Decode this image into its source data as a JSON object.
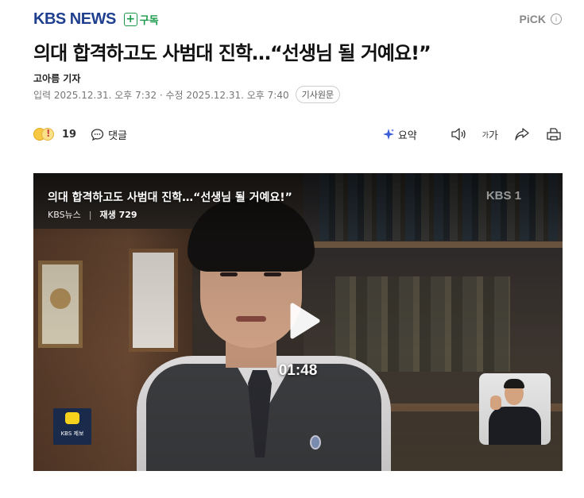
{
  "header": {
    "logo": "KBS NEWS",
    "subscribe_label": "구독",
    "pick_label": "PiCK",
    "info_glyph": "i"
  },
  "article": {
    "headline": "의대 합격하고도 사범대 진학…“선생님 될 거예요!”",
    "reporter": "고아름 기자",
    "dates": "입력 2025.12.31. 오후 7:32 · 수정 2025.12.31. 오후 7:40",
    "original_button": "기사원문"
  },
  "actions": {
    "reaction_count": "19",
    "comment_label": "댓글",
    "summary_label": "요약",
    "font_label_small": "가",
    "font_label_large": "가"
  },
  "video": {
    "title": "의대 합격하고도 사범대 진학…“선생님 될 거예요!”",
    "channel": "KBS뉴스",
    "separator": "|",
    "plays": "재생 729",
    "watermark": "KBS 1",
    "duration": "01:48",
    "report_logo_text": "KBS 제보"
  },
  "colors": {
    "brand": "#1f3f8f",
    "subscribe": "#1a9a4a",
    "summary_icon": "#3b5bdb"
  },
  "icons": [
    "plus-icon",
    "info-icon",
    "reaction-emoji-icon",
    "comment-icon",
    "summary-sparkle-icon",
    "speaker-icon",
    "font-size-icon",
    "share-icon",
    "print-icon",
    "play-icon"
  ]
}
